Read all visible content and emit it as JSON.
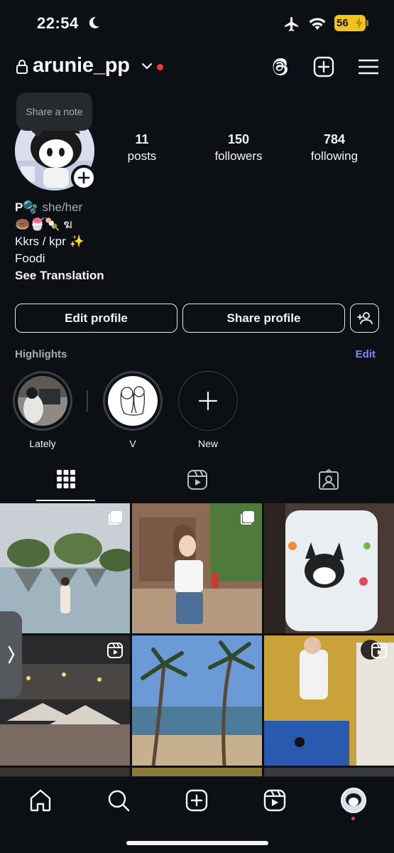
{
  "status_bar": {
    "time": "22:54",
    "battery": "56"
  },
  "header": {
    "username": "arunie_pp"
  },
  "note": {
    "text": "Share a note"
  },
  "stats": [
    {
      "value": "11",
      "label": "posts"
    },
    {
      "value": "150",
      "label": "followers"
    },
    {
      "value": "784",
      "label": "following"
    }
  ],
  "bio": {
    "name": "P🫧",
    "pronouns": "she/her",
    "line1": "🍩🍧🍡 ฆ",
    "line2": "Kkrs / kpr ✨",
    "line3": "Foodi",
    "see_translation": "See Translation"
  },
  "buttons": {
    "edit_profile": "Edit profile",
    "share_profile": "Share profile"
  },
  "highlights": {
    "title": "Highlights",
    "edit": "Edit",
    "items": [
      {
        "label": "Lately"
      },
      {
        "label": "V"
      },
      {
        "label": "New"
      }
    ]
  },
  "colors": {
    "background": "#0c1014",
    "link_blue": "#7a8cff",
    "notification_red": "#ff3040",
    "battery_yellow": "#f2c41a"
  },
  "icons": {
    "status": [
      "moon-icon",
      "airplane-icon",
      "wifi-icon",
      "battery-icon"
    ],
    "header": [
      "lock-icon",
      "chevron-down-icon",
      "threads-icon",
      "create-icon",
      "menu-icon"
    ],
    "tabs": [
      "grid-icon",
      "reels-icon",
      "tagged-icon"
    ],
    "bottom_nav": [
      "home-icon",
      "search-icon",
      "create-icon",
      "reels-icon",
      "profile-avatar"
    ]
  }
}
